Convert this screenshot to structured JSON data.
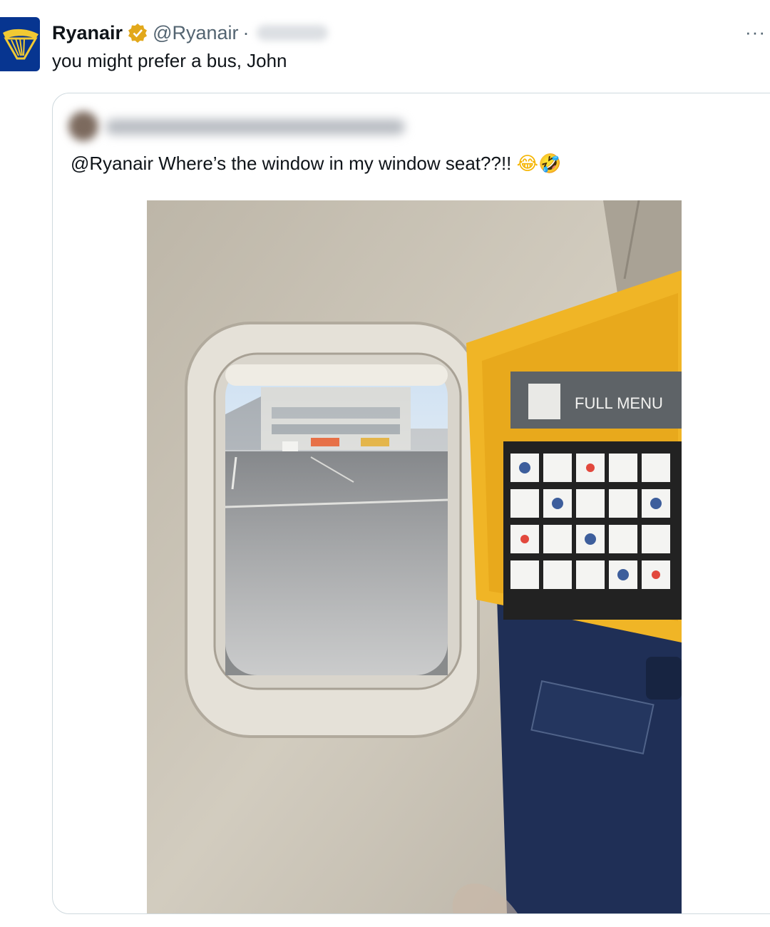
{
  "tweet": {
    "author_name": "Ryanair",
    "handle": "@Ryanair",
    "separator": "·",
    "text": "you might prefer a bus, John",
    "more_label": "···",
    "verified_color": "#e2a81b",
    "avatar_color": "#073590",
    "logo_color": "#f1c933"
  },
  "quoted_tweet": {
    "text": "@Ryanair Where’s the window in my window seat??!! ",
    "emoji": "😂🤣",
    "photo": {
      "seatback_label": "FULL MENU"
    }
  },
  "icons": {
    "avatar": "ryanair-harp-logo-icon",
    "verified": "verified-badge-icon",
    "more": "more-options-icon"
  }
}
